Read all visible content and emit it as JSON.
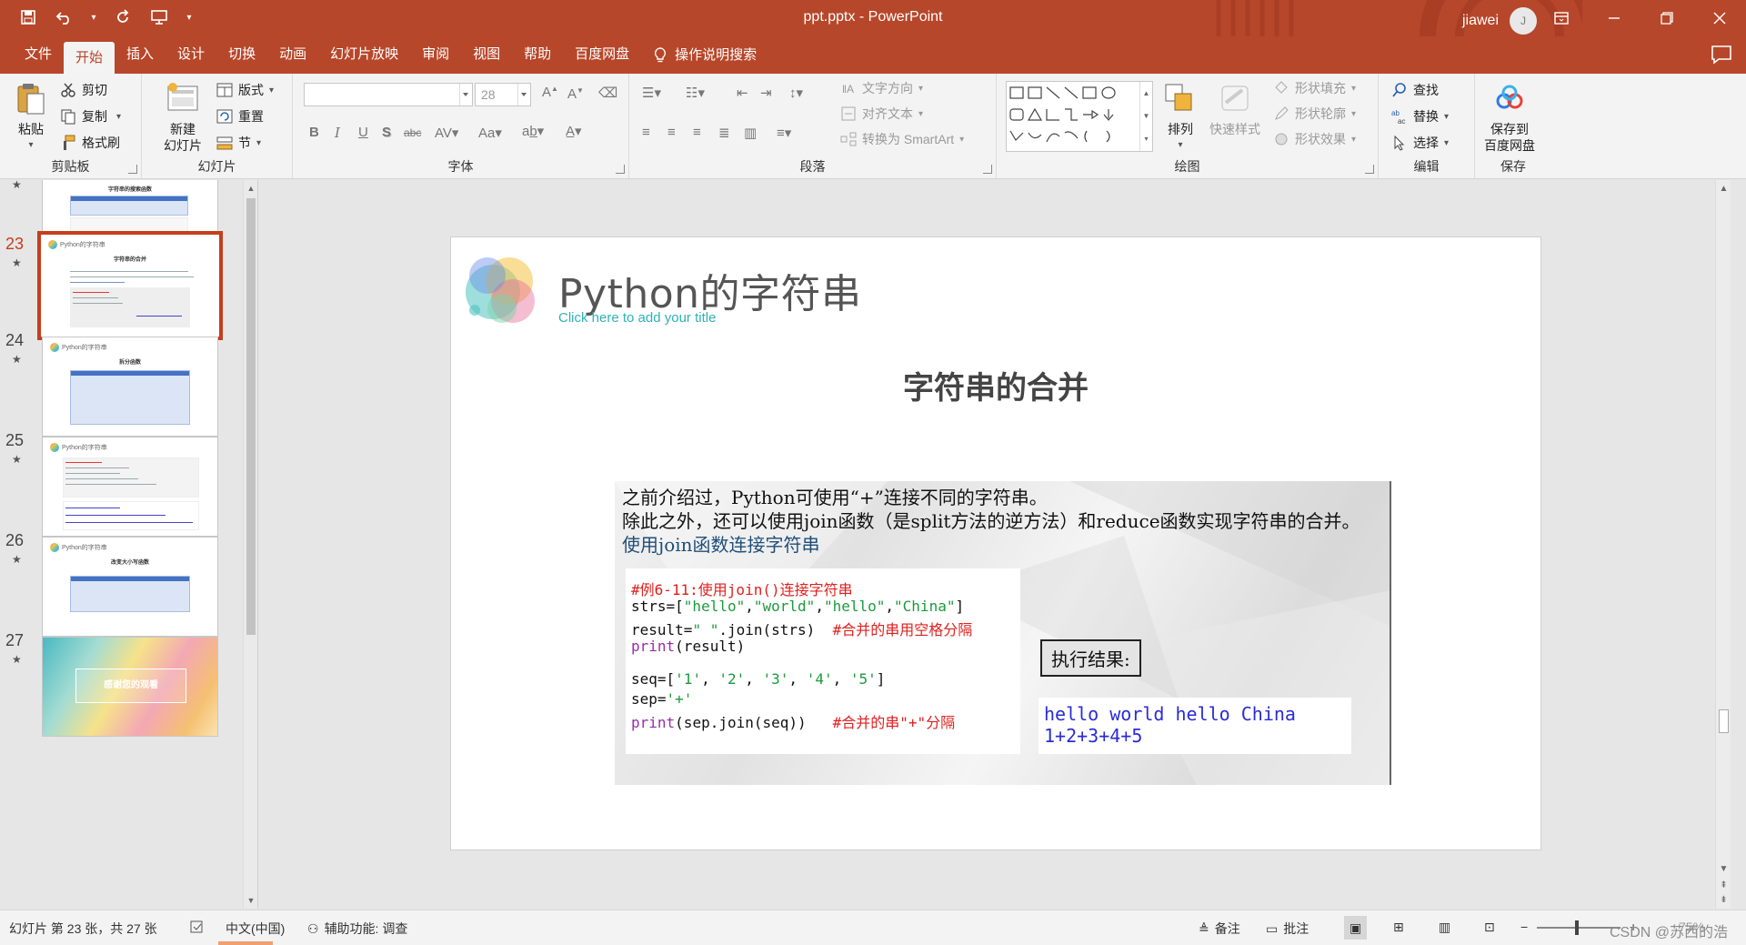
{
  "window": {
    "title": "ppt.pptx - PowerPoint",
    "user_name": "jiawei",
    "avatar_initial": "J"
  },
  "tabs": [
    {
      "label": "文件"
    },
    {
      "label": "开始",
      "active": true
    },
    {
      "label": "插入"
    },
    {
      "label": "设计"
    },
    {
      "label": "切换"
    },
    {
      "label": "动画"
    },
    {
      "label": "幻灯片放映"
    },
    {
      "label": "审阅"
    },
    {
      "label": "视图"
    },
    {
      "label": "帮助"
    },
    {
      "label": "百度网盘"
    }
  ],
  "tell_me": "操作说明搜索",
  "ribbon": {
    "clipboard": {
      "label": "剪贴板",
      "paste": "粘贴",
      "cut": "剪切",
      "copy": "复制",
      "format_painter": "格式刷"
    },
    "slides": {
      "label": "幻灯片",
      "new_slide_line1": "新建",
      "new_slide_line2": "幻灯片",
      "layout": "版式",
      "reset": "重置",
      "section": "节"
    },
    "font": {
      "label": "字体",
      "font_name": "",
      "font_size": "28"
    },
    "paragraph": {
      "label": "段落",
      "text_direction": "文字方向",
      "align_text": "对齐文本",
      "convert_smartart": "转换为 SmartArt"
    },
    "drawing": {
      "label": "绘图",
      "arrange": "排列",
      "quick_styles": "快速样式",
      "shape_fill": "形状填充",
      "shape_outline": "形状轮廓",
      "shape_effects": "形状效果"
    },
    "editing": {
      "label": "编辑",
      "find": "查找",
      "replace": "替换",
      "select": "选择"
    },
    "save": {
      "label": "保存",
      "save_to_line1": "保存到",
      "save_to_line2": "百度网盘"
    }
  },
  "thumbnails": [
    {
      "number": "",
      "title": "字符串的搜索函数"
    },
    {
      "number": "23",
      "title": "字符串的合并",
      "selected": true
    },
    {
      "number": "24",
      "title": "拆分函数"
    },
    {
      "number": "25",
      "title": ""
    },
    {
      "number": "26",
      "title": "改变大小写函数"
    },
    {
      "number": "27",
      "title": "感谢您的观看"
    }
  ],
  "thumbnail_header": "Python的字符串",
  "slide": {
    "title": "Python的字符串",
    "subtitle_placeholder": "Click here to add your title",
    "heading": "字符串的合并",
    "text_lines": [
      "之前介绍过，Python可使用“+”连接不同的字符串。",
      "除此之外，还可以使用join函数（是split方法的逆方法）和reduce函数实现字符串的合并。",
      "使用join函数连接字符串"
    ],
    "code": {
      "comment1": "#例6-11:使用join()连接字符串",
      "line_strs_a": "strs=[",
      "line_strs_items": [
        "\"hello\"",
        "\"world\"",
        "\"hello\"",
        "\"China\""
      ],
      "line_strs_b": "]",
      "line_result_a": "result=",
      "line_result_str": "\" \"",
      "line_result_b": ".join(strs)",
      "line_result_comment": "#合并的串用空格分隔",
      "line_print_kw": "print",
      "line_print_arg": "(result)",
      "line_seq_a": "seq=[",
      "line_seq_items": [
        "'1'",
        "'2'",
        "'3'",
        "'4'",
        "'5'"
      ],
      "line_seq_b": "]",
      "line_sep_a": "sep=",
      "line_sep_str": "'+'",
      "line_print2_arg": "(sep.join(seq))",
      "line_print2_comment": "#合并的串\"+\"分隔"
    },
    "result_label": "执行结果:",
    "output_lines": [
      "hello world hello China",
      "1+2+3+4+5"
    ]
  },
  "status": {
    "slide_info": "幻灯片 第 23 张，共 27 张",
    "language": "中文(中国)",
    "accessibility": "辅助功能: 调查",
    "notes": "备注",
    "comments": "批注",
    "zoom": "75%",
    "watermark": "CSDN @苏西的浩"
  }
}
